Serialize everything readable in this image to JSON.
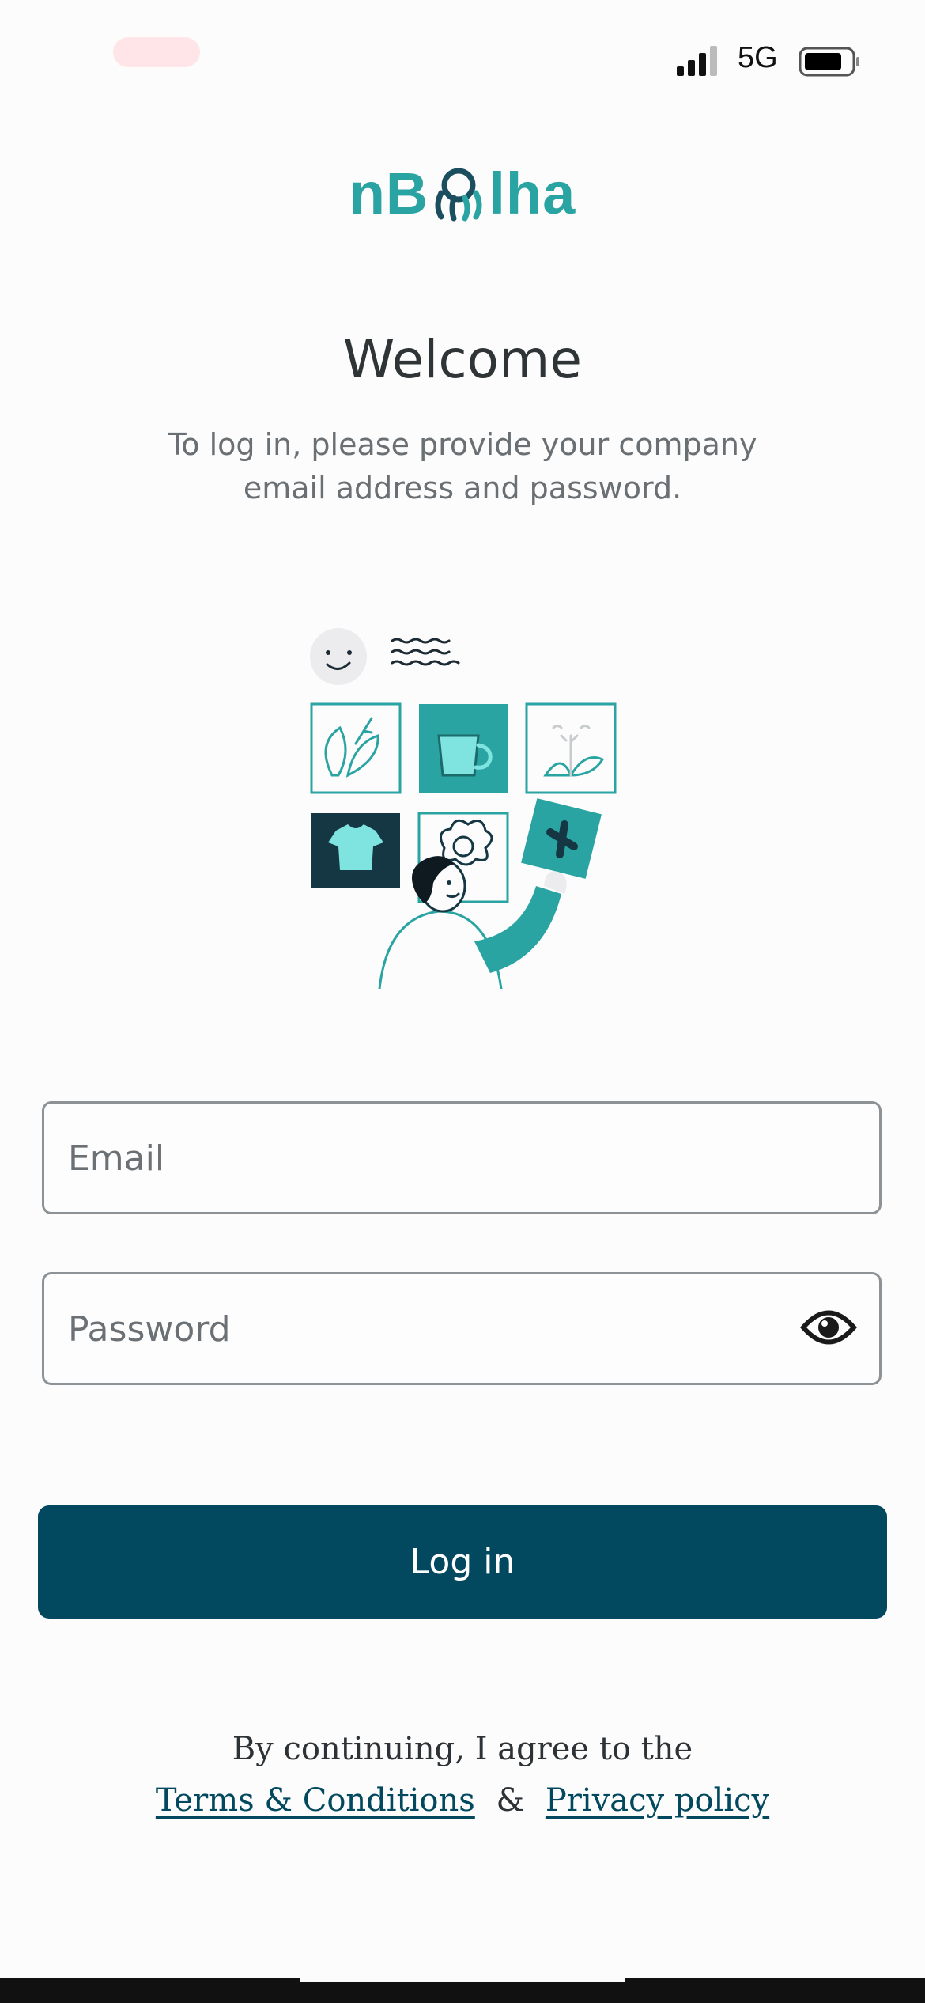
{
  "status_bar": {
    "network": "5G",
    "icons": [
      "signal-icon",
      "battery-icon"
    ]
  },
  "logo": {
    "text_left": "nB",
    "text_right": "lha",
    "brand_color": "#2aa4a2"
  },
  "welcome": {
    "title": "Welcome",
    "subtitle": "To log in, please provide your company email address and password."
  },
  "form": {
    "email_placeholder": "Email",
    "password_placeholder": "Password",
    "password_toggle_icon": "eye-icon"
  },
  "login_button": {
    "label": "Log in",
    "color": "#02485f"
  },
  "legal": {
    "prefix": "By continuing, I agree to the",
    "terms": "Terms & Conditions",
    "amp": "&",
    "privacy": "Privacy policy"
  }
}
